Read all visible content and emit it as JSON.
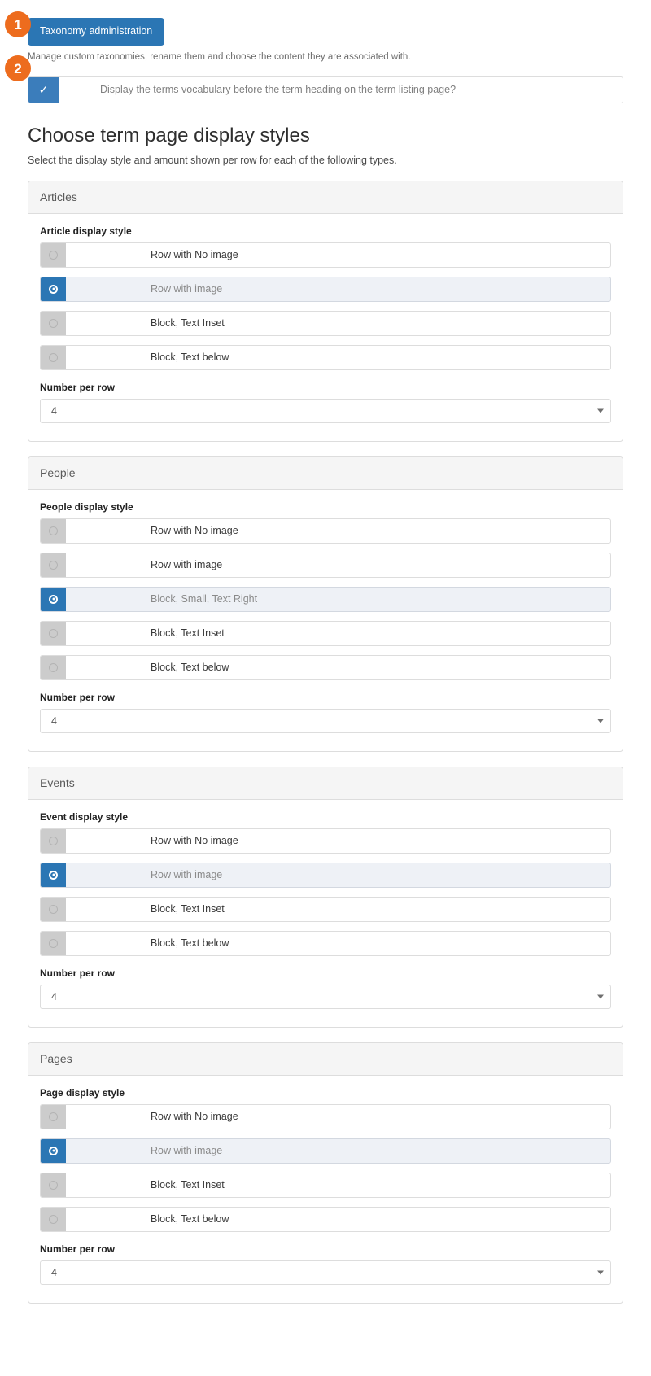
{
  "badges": {
    "one": "1",
    "two": "2"
  },
  "toolbar": {
    "taxonomy_admin_label": "Taxonomy administration",
    "help_text": "Manage custom taxonomies, rename them and choose the content they are associated with."
  },
  "vocabulary_checkbox": {
    "checked": true,
    "check_glyph": "✓",
    "label": "Display the terms vocabulary before the term heading on the term listing page?"
  },
  "heading": {
    "title": "Choose term page display styles",
    "subtitle": "Select the display style and amount shown per row for each of the following types."
  },
  "number_per_row_label": "Number per row",
  "sections": [
    {
      "panel_title": "Articles",
      "field_label": "Article display style",
      "options": [
        {
          "label": "Row with No image",
          "selected": false
        },
        {
          "label": "Row with image",
          "selected": true
        },
        {
          "label": "Block, Text Inset",
          "selected": false
        },
        {
          "label": "Block, Text below",
          "selected": false
        }
      ],
      "per_row_label": "Number per row",
      "per_row_value": "4"
    },
    {
      "panel_title": "People",
      "field_label": "People display style",
      "options": [
        {
          "label": "Row with No image",
          "selected": false
        },
        {
          "label": "Row with image",
          "selected": false
        },
        {
          "label": "Block, Small, Text Right",
          "selected": true
        },
        {
          "label": "Block, Text Inset",
          "selected": false
        },
        {
          "label": "Block, Text below",
          "selected": false
        }
      ],
      "per_row_label": "Number per row",
      "per_row_value": "4"
    },
    {
      "panel_title": "Events",
      "field_label": "Event display style",
      "options": [
        {
          "label": "Row with No image",
          "selected": false
        },
        {
          "label": "Row with image",
          "selected": true
        },
        {
          "label": "Block, Text Inset",
          "selected": false
        },
        {
          "label": "Block, Text below",
          "selected": false
        }
      ],
      "per_row_label": "Number per row",
      "per_row_value": "4"
    },
    {
      "panel_title": "Pages",
      "field_label": "Page display style",
      "options": [
        {
          "label": "Row with No image",
          "selected": false
        },
        {
          "label": "Row with image",
          "selected": true
        },
        {
          "label": "Block, Text Inset",
          "selected": false
        },
        {
          "label": "Block, Text below",
          "selected": false
        }
      ],
      "per_row_label": "Number per row",
      "per_row_value": "4"
    }
  ],
  "colors": {
    "badge_orange": "#ed6c1e",
    "primary_blue": "#2b76b4",
    "checkbox_blue": "#3b7dbb",
    "selected_row_bg": "#eef1f6",
    "radio_mark_gray": "#cccccc",
    "panel_head_bg": "#f5f5f5",
    "border_gray": "#dddddd"
  }
}
